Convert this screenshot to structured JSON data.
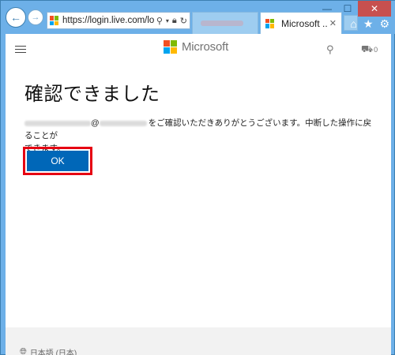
{
  "browser": {
    "url": "https://login.live.com/log",
    "active_tab_title": "Microsoft ...",
    "nav_back_symbol": "←",
    "nav_forward_symbol": "→"
  },
  "header": {
    "brand": "Microsoft",
    "cart_count": "0"
  },
  "main": {
    "heading": "確認できました",
    "message_at": "@",
    "message_body": "をご確認いただきありがとうございます。中断した操作に戻ることが",
    "message_line2": "できます。",
    "ok_button": "OK"
  },
  "footer": {
    "language": "日本語 (日本)"
  },
  "colors": {
    "ms_red": "#f25022",
    "ms_green": "#7fba00",
    "ms_blue": "#00a4ef",
    "ms_yellow": "#ffb900",
    "button_blue": "#0067b8",
    "highlight_red": "#e60012"
  },
  "icons": [
    "back-arrow-icon",
    "forward-arrow-icon",
    "microsoft-icon",
    "search-icon",
    "lock-icon",
    "refresh-icon",
    "close-icon",
    "home-icon",
    "star-icon",
    "gear-icon",
    "hamburger-icon",
    "cart-icon",
    "globe-icon"
  ]
}
